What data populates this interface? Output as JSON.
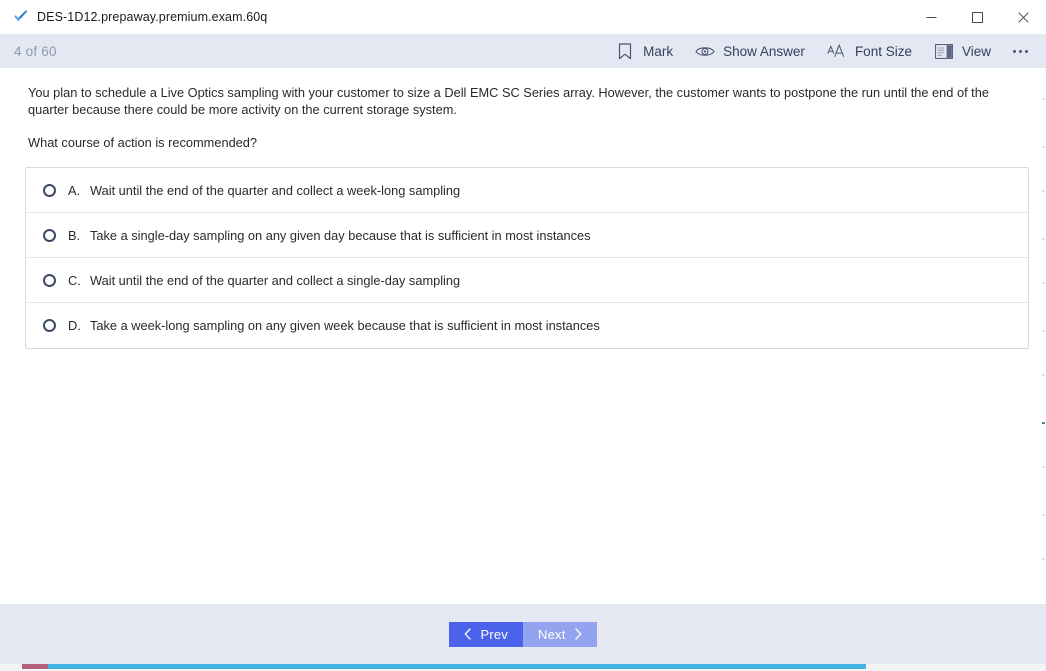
{
  "window": {
    "title": "DES-1D12.prepaway.premium.exam.60q",
    "app_icon": "blue-check-icon",
    "controls": {
      "minimize": "minimize-icon",
      "maximize": "maximize-icon",
      "close": "close-icon"
    }
  },
  "toolbar": {
    "counter": "4 of 60",
    "items": [
      {
        "label": "Mark",
        "icon": "bookmark-icon"
      },
      {
        "label": "Show Answer",
        "icon": "eye-icon"
      },
      {
        "label": "Font Size",
        "icon": "font-size-icon"
      },
      {
        "label": "View",
        "icon": "layout-panel-icon"
      }
    ],
    "overflow": "more-options-icon"
  },
  "question": {
    "stem": "You plan to schedule a Live Optics sampling with your customer to size a Dell EMC SC Series array. However, the customer wants to postpone the run until the end of the quarter because there could be more activity on the current storage system.",
    "prompt": "What course of action is recommended?",
    "options": [
      {
        "letter": "A.",
        "text": "Wait until the end of the quarter and collect a week-long sampling",
        "selected": false
      },
      {
        "letter": "B.",
        "text": "Take a single-day sampling on any given day because that is sufficient in most instances",
        "selected": false
      },
      {
        "letter": "C.",
        "text": "Wait until the end of the quarter and collect a single-day sampling",
        "selected": false
      },
      {
        "letter": "D.",
        "text": "Take a week-long sampling on any given week because that is sufficient in most instances",
        "selected": false
      }
    ]
  },
  "footer": {
    "prev_label": "Prev",
    "next_label": "Next",
    "prev_icon": "chevron-left-icon",
    "next_icon": "chevron-right-icon"
  },
  "colors": {
    "toolbar_band": "#e3e8f3",
    "prev_button": "#4b62ea",
    "next_button": "#93a3ef",
    "counter_text": "#8e9bb3",
    "body_text": "#2a2a2a"
  }
}
